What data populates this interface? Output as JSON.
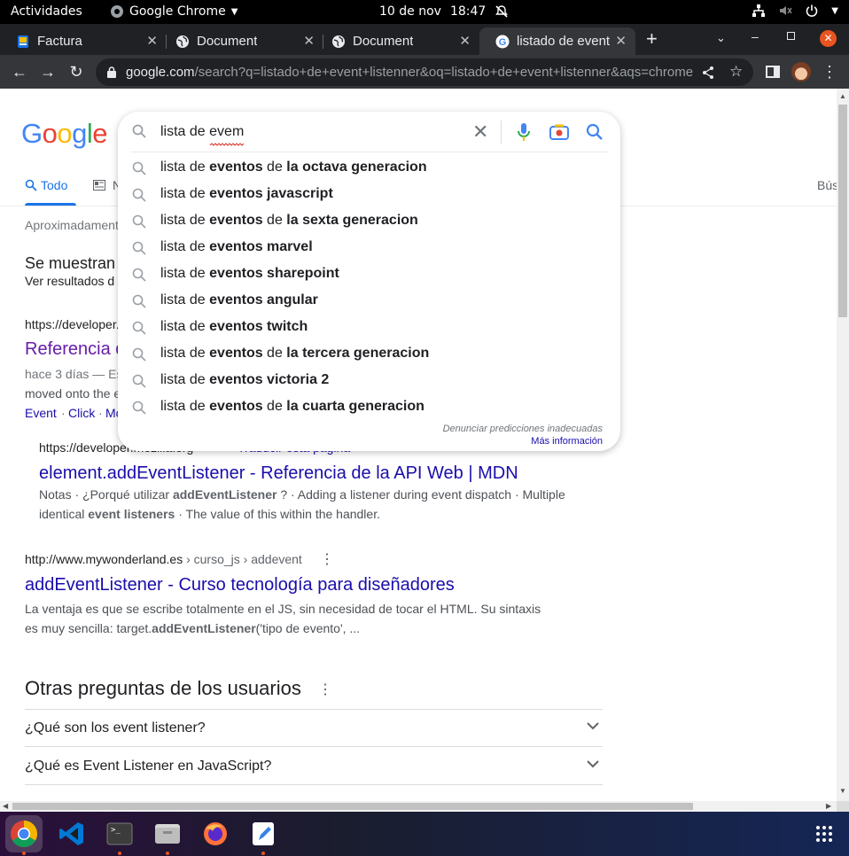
{
  "topbar": {
    "activities": "Actividades",
    "app_name": "Google Chrome",
    "date": "10 de nov",
    "time": "18:47"
  },
  "tabs": [
    {
      "label": "Factura",
      "icon": "document-favicon-icon"
    },
    {
      "label": "Document",
      "icon": "globe-icon"
    },
    {
      "label": "Document",
      "icon": "globe-icon"
    },
    {
      "label": "listado de event",
      "icon": "google-favicon-icon"
    }
  ],
  "toolbar": {
    "url_host": "google.com",
    "url_path": "/search?q=listado+de+event+listenner&oq=listado+de+event+listenner&aqs=chrome...."
  },
  "search": {
    "query": "lista de evem",
    "suggestions": [
      {
        "plain": "lista de ",
        "bold1": "eventos",
        "mid": " de ",
        "bold2": "la octava generacion"
      },
      {
        "plain": "lista de ",
        "bold1": "eventos javascript",
        "mid": "",
        "bold2": ""
      },
      {
        "plain": "lista de ",
        "bold1": "eventos",
        "mid": " de ",
        "bold2": "la sexta generacion"
      },
      {
        "plain": "lista de ",
        "bold1": "eventos marvel",
        "mid": "",
        "bold2": ""
      },
      {
        "plain": "lista de ",
        "bold1": "eventos sharepoint",
        "mid": "",
        "bold2": ""
      },
      {
        "plain": "lista de ",
        "bold1": "eventos angular",
        "mid": "",
        "bold2": ""
      },
      {
        "plain": "lista de ",
        "bold1": "eventos twitch",
        "mid": "",
        "bold2": ""
      },
      {
        "plain": "lista de ",
        "bold1": "eventos",
        "mid": " de ",
        "bold2": "la tercera generacion"
      },
      {
        "plain": "lista de ",
        "bold1": "eventos victoria 2",
        "mid": "",
        "bold2": ""
      },
      {
        "plain": "lista de ",
        "bold1": "eventos",
        "mid": " de ",
        "bold2": "la cuarta generacion"
      }
    ],
    "report": "Denunciar predicciones inadecuadas",
    "more_info": "Más información"
  },
  "page": {
    "logo": "Google",
    "tab_all": "Todo",
    "tab_n": "N",
    "tab_right": "Bús",
    "stats": "Aproximadamente",
    "showing": "Se muestran",
    "see_results": "Ver resultados d",
    "r1_cite": "https://developer.",
    "r1_title": "Referencia d",
    "r1_snip_a": "hace 3 días — Es",
    "r1_snip_b": "moved onto the e",
    "r1_links": [
      "Event",
      "Click",
      "Mo"
    ],
    "r2_cite": "https://developer.mozilla.org",
    "r2_translate": "Traducir esta página",
    "r2_title": "element.addEventListener - Referencia de la API Web | MDN",
    "r2_snip_1a": "Notas · ¿Porqué utilizar ",
    "r2_snip_1b": "addEventListener",
    "r2_snip_1c": " ? · Adding a listener during event dispatch · Multiple",
    "r2_snip_2a": "identical ",
    "r2_snip_2b": "event listeners",
    "r2_snip_2c": " · The value of this within the handler.",
    "r3_cite_host": "http://www.mywonderland.es",
    "r3_cite_path": " › curso_js › addevent",
    "r3_title": "addEventListener - Curso tecnología para diseñadores",
    "r3_snip_1": "La ventaja es que se escribe totalmente en el JS, sin necesidad de tocar el HTML. Su sintaxis",
    "r3_snip_2a": "es muy sencilla: target.",
    "r3_snip_2b": "addEventListener",
    "r3_snip_2c": "('tipo de evento', ...",
    "faq_title": "Otras preguntas de los usuarios",
    "faq": [
      "¿Qué son los event listener?",
      "¿Qué es Event Listener en JavaScript?"
    ]
  },
  "colors": {
    "accent": "#1a73e8",
    "link": "#1a0dab",
    "visited": "#681da8",
    "ubuntu_orange": "#e95420"
  }
}
